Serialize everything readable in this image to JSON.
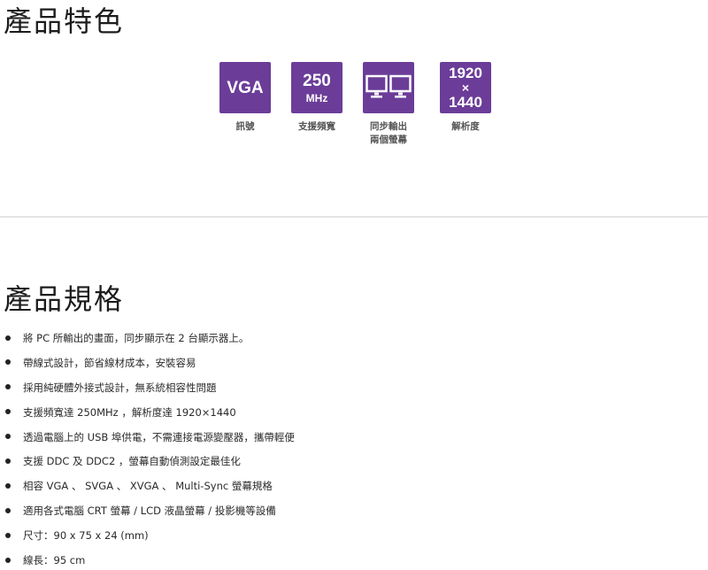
{
  "features_section": {
    "title": "產品特色",
    "items": [
      {
        "lines": [
          "VGA"
        ],
        "caption": "訊號"
      },
      {
        "lines": [
          "250",
          "MHz"
        ],
        "caption": "支援頻寬"
      },
      {
        "icon": "dual-monitor-icon",
        "caption_lines": [
          "同步輸出",
          "兩個螢幕"
        ]
      },
      {
        "lines": [
          "1920",
          "×",
          "1440"
        ],
        "caption": "解析度"
      }
    ],
    "tile_color": "#6b3d98"
  },
  "specs_section": {
    "title": "產品規格",
    "items": [
      "將 PC 所輸出的畫面，同步顯示在 2 台顯示器上。",
      "帶線式設計，節省線材成本，安裝容易",
      "採用純硬體外接式設計，無系統相容性問題",
      "支援頻寬達 250MHz ，解析度達 1920×1440",
      "透過電腦上的 USB 埠供電，不需連接電源變壓器，攜帶輕便",
      "支援 DDC 及 DDC2 ，螢幕自動偵測設定最佳化",
      "相容 VGA 、 SVGA 、 XVGA 、 Multi-Sync 螢幕規格",
      "適用各式電腦 CRT 螢幕 / LCD 液晶螢幕 / 投影機等設備",
      "尺寸：90 x 75 x 24 (mm)",
      "線長：95 cm"
    ]
  }
}
